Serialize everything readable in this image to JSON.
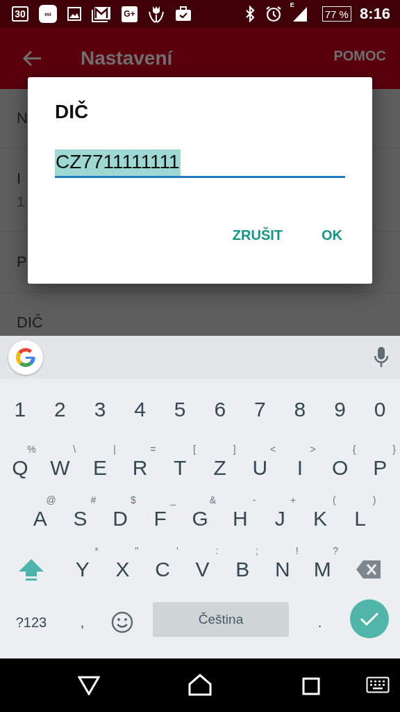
{
  "status_bar": {
    "notifications": [
      {
        "kind": "calendar",
        "text": "30"
      },
      {
        "kind": "mi",
        "text": "mi"
      },
      {
        "kind": "gallery"
      },
      {
        "kind": "mail"
      },
      {
        "kind": "gplus",
        "text": "G+"
      },
      {
        "kind": "tulip"
      },
      {
        "kind": "briefcase"
      }
    ],
    "network": "E",
    "battery": "77 %",
    "time": "8:16"
  },
  "app_bar": {
    "title": "Nastavení",
    "action": "POMOC"
  },
  "settings_list": [
    {
      "title": "N"
    },
    {
      "title": "I",
      "subtitle": "1"
    },
    {
      "title": "P"
    },
    {
      "title": "DIČ"
    }
  ],
  "dialog": {
    "title": "DIČ",
    "field": {
      "value": "CZ7711111111",
      "selected": true
    },
    "buttons": [
      "ZRUŠIT",
      "OK"
    ]
  },
  "keyboard": {
    "rows": [
      [
        {
          "kind": "char",
          "label": "1"
        },
        {
          "kind": "char",
          "label": "2"
        },
        {
          "kind": "char",
          "label": "3"
        },
        {
          "kind": "char",
          "label": "4"
        },
        {
          "kind": "char",
          "label": "5"
        },
        {
          "kind": "char",
          "label": "6"
        },
        {
          "kind": "char",
          "label": "7"
        },
        {
          "kind": "char",
          "label": "8"
        },
        {
          "kind": "char",
          "label": "9"
        },
        {
          "kind": "char",
          "label": "0"
        }
      ],
      [
        {
          "kind": "char",
          "label": "Q",
          "hint": "%"
        },
        {
          "kind": "char",
          "label": "W",
          "hint": "\\"
        },
        {
          "kind": "char",
          "label": "E",
          "hint": "|"
        },
        {
          "kind": "char",
          "label": "R",
          "hint": "="
        },
        {
          "kind": "char",
          "label": "T",
          "hint": "["
        },
        {
          "kind": "char",
          "label": "Z",
          "hint": "]"
        },
        {
          "kind": "char",
          "label": "U",
          "hint": "<"
        },
        {
          "kind": "char",
          "label": "I",
          "hint": ">"
        },
        {
          "kind": "char",
          "label": "O",
          "hint": "{"
        },
        {
          "kind": "char",
          "label": "P",
          "hint": "}"
        }
      ],
      [
        {
          "kind": "char",
          "label": "A",
          "hint": "@"
        },
        {
          "kind": "char",
          "label": "S",
          "hint": "#"
        },
        {
          "kind": "char",
          "label": "D",
          "hint": "$"
        },
        {
          "kind": "char",
          "label": "F",
          "hint": "_"
        },
        {
          "kind": "char",
          "label": "G",
          "hint": "&"
        },
        {
          "kind": "char",
          "label": "H",
          "hint": "-"
        },
        {
          "kind": "char",
          "label": "J",
          "hint": "+"
        },
        {
          "kind": "char",
          "label": "K",
          "hint": "("
        },
        {
          "kind": "char",
          "label": "L",
          "hint": ")"
        }
      ],
      [
        {
          "kind": "shift",
          "on": true
        },
        {
          "kind": "char",
          "label": "Y",
          "hint": "*"
        },
        {
          "kind": "char",
          "label": "X",
          "hint": "\""
        },
        {
          "kind": "char",
          "label": "C",
          "hint": "'"
        },
        {
          "kind": "char",
          "label": "V",
          "hint": ":"
        },
        {
          "kind": "char",
          "label": "B",
          "hint": ";"
        },
        {
          "kind": "char",
          "label": "N",
          "hint": "!"
        },
        {
          "kind": "char",
          "label": "M",
          "hint": "?"
        },
        {
          "kind": "backspace"
        }
      ],
      [
        {
          "kind": "mode",
          "label": "?123"
        },
        {
          "kind": "char",
          "label": ","
        },
        {
          "kind": "emoji"
        },
        {
          "kind": "space",
          "label": "Čeština"
        },
        {
          "kind": "char",
          "label": "."
        },
        {
          "kind": "enter"
        }
      ]
    ]
  }
}
